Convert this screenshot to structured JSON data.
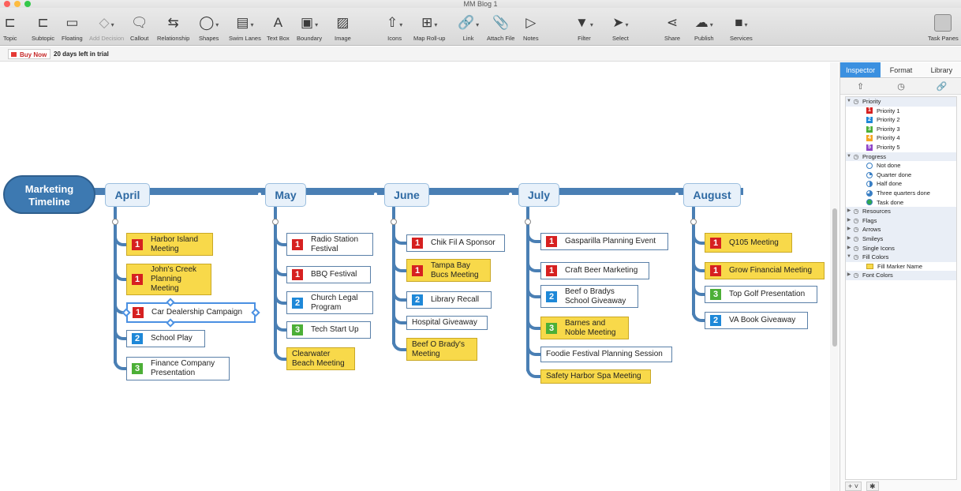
{
  "window": {
    "title": "MM Blog 1"
  },
  "toolbar": {
    "items": [
      {
        "label": "Topic",
        "icon": "topic-icon",
        "glyph": "⊏"
      },
      {
        "label": "Subtopic",
        "icon": "subtopic-icon",
        "glyph": "⊏"
      },
      {
        "label": "Floating",
        "icon": "floating-icon",
        "glyph": "▭"
      },
      {
        "label": "Add Decision",
        "icon": "decision-icon",
        "glyph": "◇"
      },
      {
        "label": "Callout",
        "icon": "callout-icon",
        "glyph": "🗨"
      },
      {
        "label": "Relationship",
        "icon": "relationship-icon",
        "glyph": "⇆"
      },
      {
        "label": "Shapes",
        "icon": "shapes-icon",
        "glyph": "◯"
      },
      {
        "label": "Swim Lanes",
        "icon": "swimlanes-icon",
        "glyph": "▤"
      },
      {
        "label": "Text Box",
        "icon": "textbox-icon",
        "glyph": "A"
      },
      {
        "label": "Boundary",
        "icon": "boundary-icon",
        "glyph": "▣"
      },
      {
        "label": "Image",
        "icon": "image-icon",
        "glyph": "▨"
      },
      {
        "label": "Icons",
        "icon": "icons-icon",
        "glyph": "⇧"
      },
      {
        "label": "Map Roll-up",
        "icon": "rollup-icon",
        "glyph": "⊞"
      },
      {
        "label": "Link",
        "icon": "link-icon",
        "glyph": "🔗"
      },
      {
        "label": "Attach File",
        "icon": "attach-icon",
        "glyph": "📎"
      },
      {
        "label": "Notes",
        "icon": "notes-icon",
        "glyph": "▷"
      },
      {
        "label": "Filter",
        "icon": "filter-icon",
        "glyph": "▼"
      },
      {
        "label": "Select",
        "icon": "select-icon",
        "glyph": "➤"
      },
      {
        "label": "Share",
        "icon": "share-icon",
        "glyph": "⋖"
      },
      {
        "label": "Publish",
        "icon": "publish-icon",
        "glyph": "☁"
      },
      {
        "label": "Services",
        "icon": "services-icon",
        "glyph": "■"
      },
      {
        "label": "Task Panes",
        "icon": "taskpanes-icon",
        "glyph": ""
      }
    ]
  },
  "trial": {
    "buy_now": "Buy Now",
    "days_left": "20 days left in trial"
  },
  "map": {
    "center": "Marketing Timeline",
    "months": [
      {
        "label": "April",
        "topics": [
          {
            "text": "Harbor Island Meeting",
            "priority": "1",
            "fill": "yellow"
          },
          {
            "text": "John's Creek Planning Meeting",
            "priority": "1",
            "fill": "yellow"
          },
          {
            "text": "Car Dealership Campaign",
            "priority": "1",
            "fill": "white",
            "selected": true
          },
          {
            "text": "School Play",
            "priority": "2",
            "fill": "white"
          },
          {
            "text": "Finance Company Presentation",
            "priority": "3",
            "fill": "white"
          }
        ]
      },
      {
        "label": "May",
        "topics": [
          {
            "text": "Radio Station Festival",
            "priority": "1",
            "fill": "white"
          },
          {
            "text": "BBQ Festival",
            "priority": "1",
            "fill": "white"
          },
          {
            "text": "Church Legal Program",
            "priority": "2",
            "fill": "white"
          },
          {
            "text": "Tech Start Up",
            "priority": "3",
            "fill": "white"
          },
          {
            "text": "Clearwater Beach Meeting",
            "priority": "",
            "fill": "yellow"
          }
        ]
      },
      {
        "label": "June",
        "topics": [
          {
            "text": "Chik Fil A Sponsor",
            "priority": "1",
            "fill": "white"
          },
          {
            "text": "Tampa Bay Bucs Meeting",
            "priority": "1",
            "fill": "yellow"
          },
          {
            "text": "Library Recall",
            "priority": "2",
            "fill": "white"
          },
          {
            "text": "Hospital Giveaway",
            "priority": "",
            "fill": "white"
          },
          {
            "text": "Beef O Brady's Meeting",
            "priority": "",
            "fill": "yellow"
          }
        ]
      },
      {
        "label": "July",
        "topics": [
          {
            "text": "Gasparilla Planning Event",
            "priority": "1",
            "fill": "white"
          },
          {
            "text": "Craft Beer Marketing",
            "priority": "1",
            "fill": "white"
          },
          {
            "text": "Beef o Bradys School Giveaway",
            "priority": "2",
            "fill": "white"
          },
          {
            "text": "Barnes and Noble Meeting",
            "priority": "3",
            "fill": "yellow"
          },
          {
            "text": "Foodie Festival Planning Session",
            "priority": "",
            "fill": "white"
          },
          {
            "text": "Safety Harbor Spa Meeting",
            "priority": "",
            "fill": "yellow"
          }
        ]
      },
      {
        "label": "August",
        "topics": [
          {
            "text": "Q105 Meeting",
            "priority": "1",
            "fill": "yellow"
          },
          {
            "text": "Grow Financial Meeting",
            "priority": "1",
            "fill": "yellow"
          },
          {
            "text": "Top Golf Presentation",
            "priority": "3",
            "fill": "white"
          },
          {
            "text": "VA Book Giveaway",
            "priority": "2",
            "fill": "white"
          }
        ]
      }
    ]
  },
  "panel": {
    "tabs": [
      "Inspector",
      "Format",
      "Library"
    ],
    "active_tab": "Inspector",
    "subtabs": [
      {
        "glyph": "⇧",
        "icon": "icons-tab-icon"
      },
      {
        "glyph": "◷",
        "icon": "clock-tab-icon"
      },
      {
        "glyph": "🔗",
        "icon": "link-tab-icon"
      }
    ],
    "tree": [
      {
        "kind": "group",
        "label": "Priority",
        "expanded": true,
        "icon": "priority-icon"
      },
      {
        "kind": "priority",
        "label": "Priority 1",
        "n": "1"
      },
      {
        "kind": "priority",
        "label": "Priority 2",
        "n": "2"
      },
      {
        "kind": "priority",
        "label": "Priority 3",
        "n": "3"
      },
      {
        "kind": "priority",
        "label": "Priority 4",
        "n": "4"
      },
      {
        "kind": "priority",
        "label": "Priority 5",
        "n": "5"
      },
      {
        "kind": "group",
        "label": "Progress",
        "expanded": true,
        "icon": "progress-icon"
      },
      {
        "kind": "progress",
        "label": "Not done",
        "state": "n"
      },
      {
        "kind": "progress",
        "label": "Quarter done",
        "state": "q"
      },
      {
        "kind": "progress",
        "label": "Half done",
        "state": "h"
      },
      {
        "kind": "progress",
        "label": "Three quarters done",
        "state": "t"
      },
      {
        "kind": "progress",
        "label": "Task done",
        "state": "d"
      },
      {
        "kind": "group",
        "label": "Resources",
        "expanded": false,
        "icon": "resources-icon"
      },
      {
        "kind": "group",
        "label": "Flags",
        "expanded": false,
        "icon": "flags-icon"
      },
      {
        "kind": "group",
        "label": "Arrows",
        "expanded": false,
        "icon": "arrows-icon"
      },
      {
        "kind": "group",
        "label": "Smileys",
        "expanded": false,
        "icon": "smileys-icon"
      },
      {
        "kind": "group",
        "label": "Single Icons",
        "expanded": false,
        "icon": "single-icons-icon"
      },
      {
        "kind": "group",
        "label": "Fill Colors",
        "expanded": true,
        "icon": "fill-colors-icon"
      },
      {
        "kind": "fill",
        "label": "Fill Marker Name"
      },
      {
        "kind": "group",
        "label": "Font Colors",
        "expanded": false,
        "icon": "font-colors-icon"
      }
    ],
    "footer": [
      "+ ˅",
      "✱"
    ]
  },
  "colors": {
    "accent": "#3b90e0",
    "line": "#4a7fb4",
    "center": "#3d79b1",
    "yellow_fill": "#f8d94a",
    "priority_1": "#d62020",
    "priority_2": "#1e88d8",
    "priority_3": "#4caf37"
  }
}
